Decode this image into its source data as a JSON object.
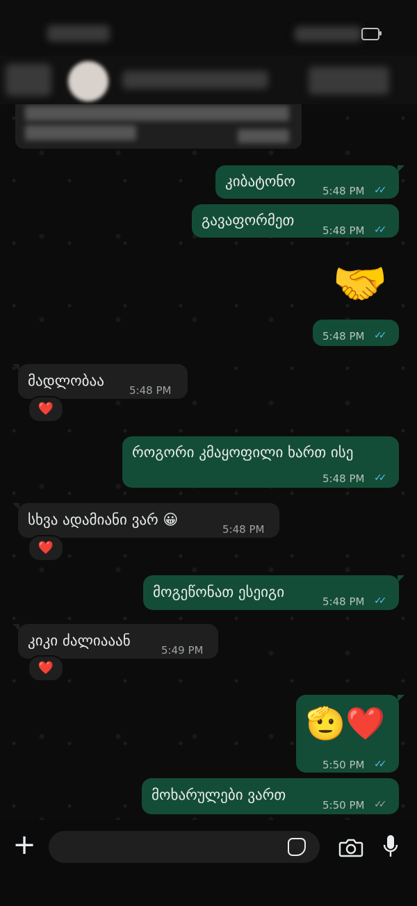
{
  "composer": {
    "placeholder": ""
  },
  "messages": [
    {
      "direction": "out",
      "text": "კიბატონო",
      "time": "5:48 PM",
      "status": "read"
    },
    {
      "direction": "out",
      "text": "გავაფორმეთ",
      "time": "5:48 PM",
      "status": "read"
    },
    {
      "direction": "out",
      "emoji": "🤝",
      "time": "5:48 PM",
      "status": "read"
    },
    {
      "direction": "in",
      "text": "მადლობაა",
      "time": "5:48 PM",
      "reaction": "❤️"
    },
    {
      "direction": "out",
      "text": "როგორი კმაყოფილი ხართ ისე",
      "time": "5:48 PM",
      "status": "read"
    },
    {
      "direction": "in",
      "text": "სხვა ადამიანი ვარ 😀",
      "time": "5:48 PM",
      "reaction": "❤️"
    },
    {
      "direction": "out",
      "text": "მოგეწონათ ესეიგი",
      "time": "5:48 PM",
      "status": "read"
    },
    {
      "direction": "in",
      "text": "კიკი ძალიააან",
      "time": "5:49 PM",
      "reaction": "❤️"
    },
    {
      "direction": "out",
      "emoji": "🫡❤️",
      "time": "5:50 PM",
      "status": "read"
    },
    {
      "direction": "out",
      "text": "მოხარულები ვართ",
      "time": "5:50 PM",
      "status": "delivered"
    }
  ],
  "icons": {
    "add": "plus-icon",
    "sticker": "sticker-icon",
    "camera": "camera-icon",
    "mic": "microphone-icon",
    "tick": "double-check-icon"
  },
  "colors": {
    "outgoing_bubble": "#144d37",
    "incoming_bubble": "#1f1f1f",
    "read_ticks": "#53bdeb",
    "delivered_ticks": "#9ea3a6"
  }
}
